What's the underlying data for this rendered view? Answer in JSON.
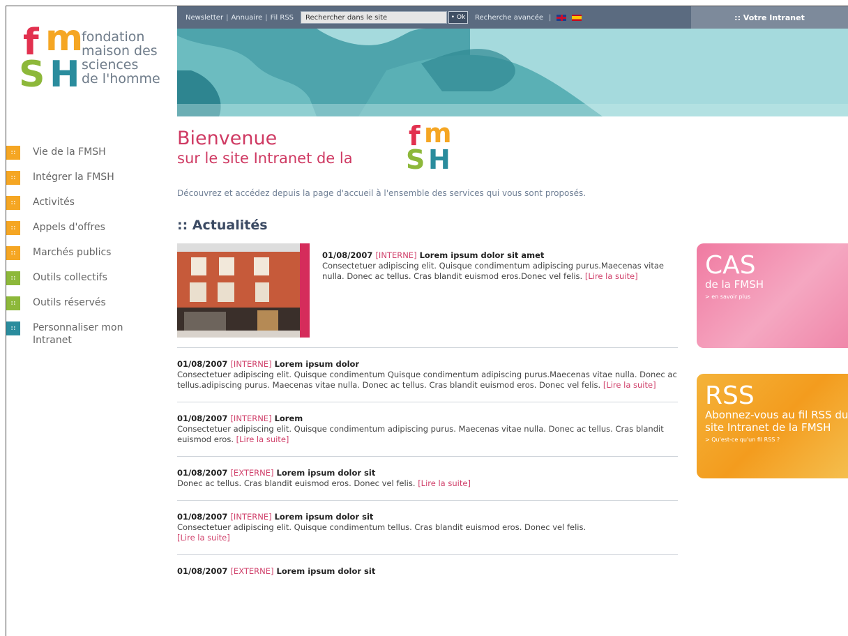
{
  "logo": {
    "letters": [
      "f",
      "m",
      "S",
      "H"
    ],
    "text_lines": [
      "fondation",
      "maison des",
      "sciences",
      "de l'homme"
    ],
    "colors": {
      "f": "#e2314f",
      "m": "#f5a623",
      "S": "#8db83a",
      "H": "#2a8c9d"
    }
  },
  "topbar": {
    "links": [
      "Newsletter",
      "Annuaire",
      "Fil RSS"
    ],
    "search_placeholder": "Rechercher dans le site",
    "ok_label": "• Ok",
    "advanced_label": "Recherche avancée",
    "intranet_label": ":: Votre Intranet"
  },
  "nav": {
    "items": [
      {
        "label": "Vie de la FMSH",
        "color": "#f5a623"
      },
      {
        "label": "Intégrer la FMSH",
        "color": "#f5a623"
      },
      {
        "label": "Activités",
        "color": "#f5a623"
      },
      {
        "label": "Appels d'offres",
        "color": "#f5a623"
      },
      {
        "label": "Marchés publics",
        "color": "#f5a623"
      },
      {
        "label": "Outils collectifs",
        "color": "#8db83a"
      },
      {
        "label": "Outils réservés",
        "color": "#8db83a"
      },
      {
        "label": "Personnaliser mon Intranet",
        "color": "#2a8c9d"
      }
    ]
  },
  "welcome": {
    "line1": "Bienvenue",
    "line2": "sur le site Intranet de la",
    "intro": "Découvrez et accédez depuis la page d'accueil à l'ensemble des services qui vous sont proposés."
  },
  "section_title": ":: Actualités",
  "news": [
    {
      "date": "01/08/2007",
      "tag": "[INTERNE]",
      "title": "Lorem ipsum dolor sit amet",
      "body": "Consectetuer adipiscing elit. Quisque condimentum adipiscing purus.Maecenas vitae nulla. Donec ac tellus. Cras blandit euismod eros.Donec vel felis.",
      "more": "[Lire la suite]"
    },
    {
      "date": "01/08/2007",
      "tag": "[INTERNE]",
      "title": "Lorem ipsum dolor",
      "body": "Consectetuer adipiscing elit. Quisque condimentum Quisque condimentum adipiscing purus.Maecenas vitae nulla. Donec ac tellus.adipiscing purus. Maecenas vitae nulla. Donec ac tellus. Cras blandit euismod eros. Donec vel felis.",
      "more": "[Lire la suite]"
    },
    {
      "date": "01/08/2007",
      "tag": "[INTERNE]",
      "title": "Lorem",
      "body": "Consectetuer adipiscing elit. Quisque condimentum adipiscing purus. Maecenas vitae nulla. Donec ac tellus. Cras blandit euismod eros.",
      "more": "[Lire la suite]"
    },
    {
      "date": "01/08/2007",
      "tag": "[EXTERNE]",
      "title": "Lorem ipsum dolor sit",
      "body": "Donec ac tellus. Cras blandit euismod eros. Donec vel felis.",
      "more": "[Lire la suite]"
    },
    {
      "date": "01/08/2007",
      "tag": "[INTERNE]",
      "title": "Lorem ipsum dolor sit",
      "body": "Consectetuer adipiscing elit. Quisque condimentum tellus. Cras blandit euismod eros. Donec vel felis.",
      "more": "[Lire la suite]"
    },
    {
      "date": "01/08/2007",
      "tag": "[EXTERNE]",
      "title": "Lorem ipsum dolor sit",
      "body": "",
      "more": ""
    }
  ],
  "promos": {
    "cas": {
      "big": "CAS",
      "sub": "de la FMSH",
      "small": "> en savoir plus"
    },
    "rss": {
      "big": "RSS",
      "sub": "Abonnez-vous au fil RSS du site Intranet de la FMSH",
      "small": "> Qu'est-ce qu'un fil RSS ?"
    }
  }
}
